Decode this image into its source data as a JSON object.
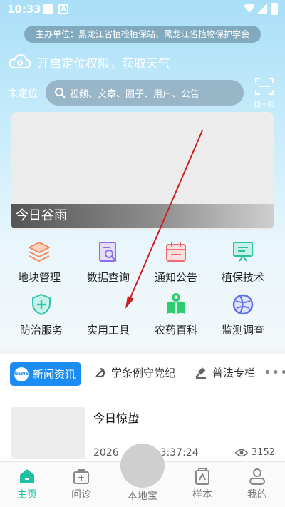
{
  "status_bar": {
    "time": "10:33"
  },
  "header": {
    "sponsor": "主办单位：黑龙江省植检植保站、黑龙江省植物保护学会",
    "weather_text": "开启定位权限，获取天气",
    "location_label": "未定位",
    "search": {
      "placeholder": "视频、文章、圈子、用户、公告"
    },
    "scan_label": "扫一扫"
  },
  "banner": {
    "caption": "今日谷雨"
  },
  "grid": {
    "items": [
      {
        "label": "地块管理",
        "icon": "layers-icon",
        "color": "#f28a5a"
      },
      {
        "label": "数据查询",
        "icon": "document-search-icon",
        "color": "#8b6ee8"
      },
      {
        "label": "通知公告",
        "icon": "calendar-icon",
        "color": "#ef6a6a"
      },
      {
        "label": "植保技术",
        "icon": "presentation-icon",
        "color": "#28c2a0"
      },
      {
        "label": "防治服务",
        "icon": "shield-plus-icon",
        "color": "#2ec4b0"
      },
      {
        "label": "实用工具",
        "icon": "toolbox-icon",
        "color": "#cccccc"
      },
      {
        "label": "农药百科",
        "icon": "book-leaf-icon",
        "color": "#2ecc71"
      },
      {
        "label": "监测调查",
        "icon": "globe-icon",
        "color": "#5b6ef0"
      }
    ]
  },
  "tabs": {
    "items": [
      {
        "label": "新闻资讯",
        "badge": "NEWS",
        "active": true
      },
      {
        "label": "学条例守党纪",
        "icon": "party-emblem-icon"
      },
      {
        "label": "普法专栏",
        "icon": "gavel-icon"
      }
    ],
    "more": "•••"
  },
  "news": [
    {
      "title": "今日惊蛰",
      "date": "2026",
      "time": "3:37:24",
      "views": "3152"
    }
  ],
  "bottom_nav": {
    "items": [
      {
        "label": "主页",
        "icon": "home-icon",
        "active": true
      },
      {
        "label": "问诊",
        "icon": "medical-kit-icon"
      },
      {
        "label": "本地宝",
        "icon": "center-button"
      },
      {
        "label": "样本",
        "icon": "sample-icon"
      },
      {
        "label": "我的",
        "icon": "user-icon"
      }
    ]
  },
  "colors": {
    "accent": "#1b8cf4",
    "nav_active": "#1fc0a0",
    "annotation_arrow": "#cc1f1f"
  }
}
